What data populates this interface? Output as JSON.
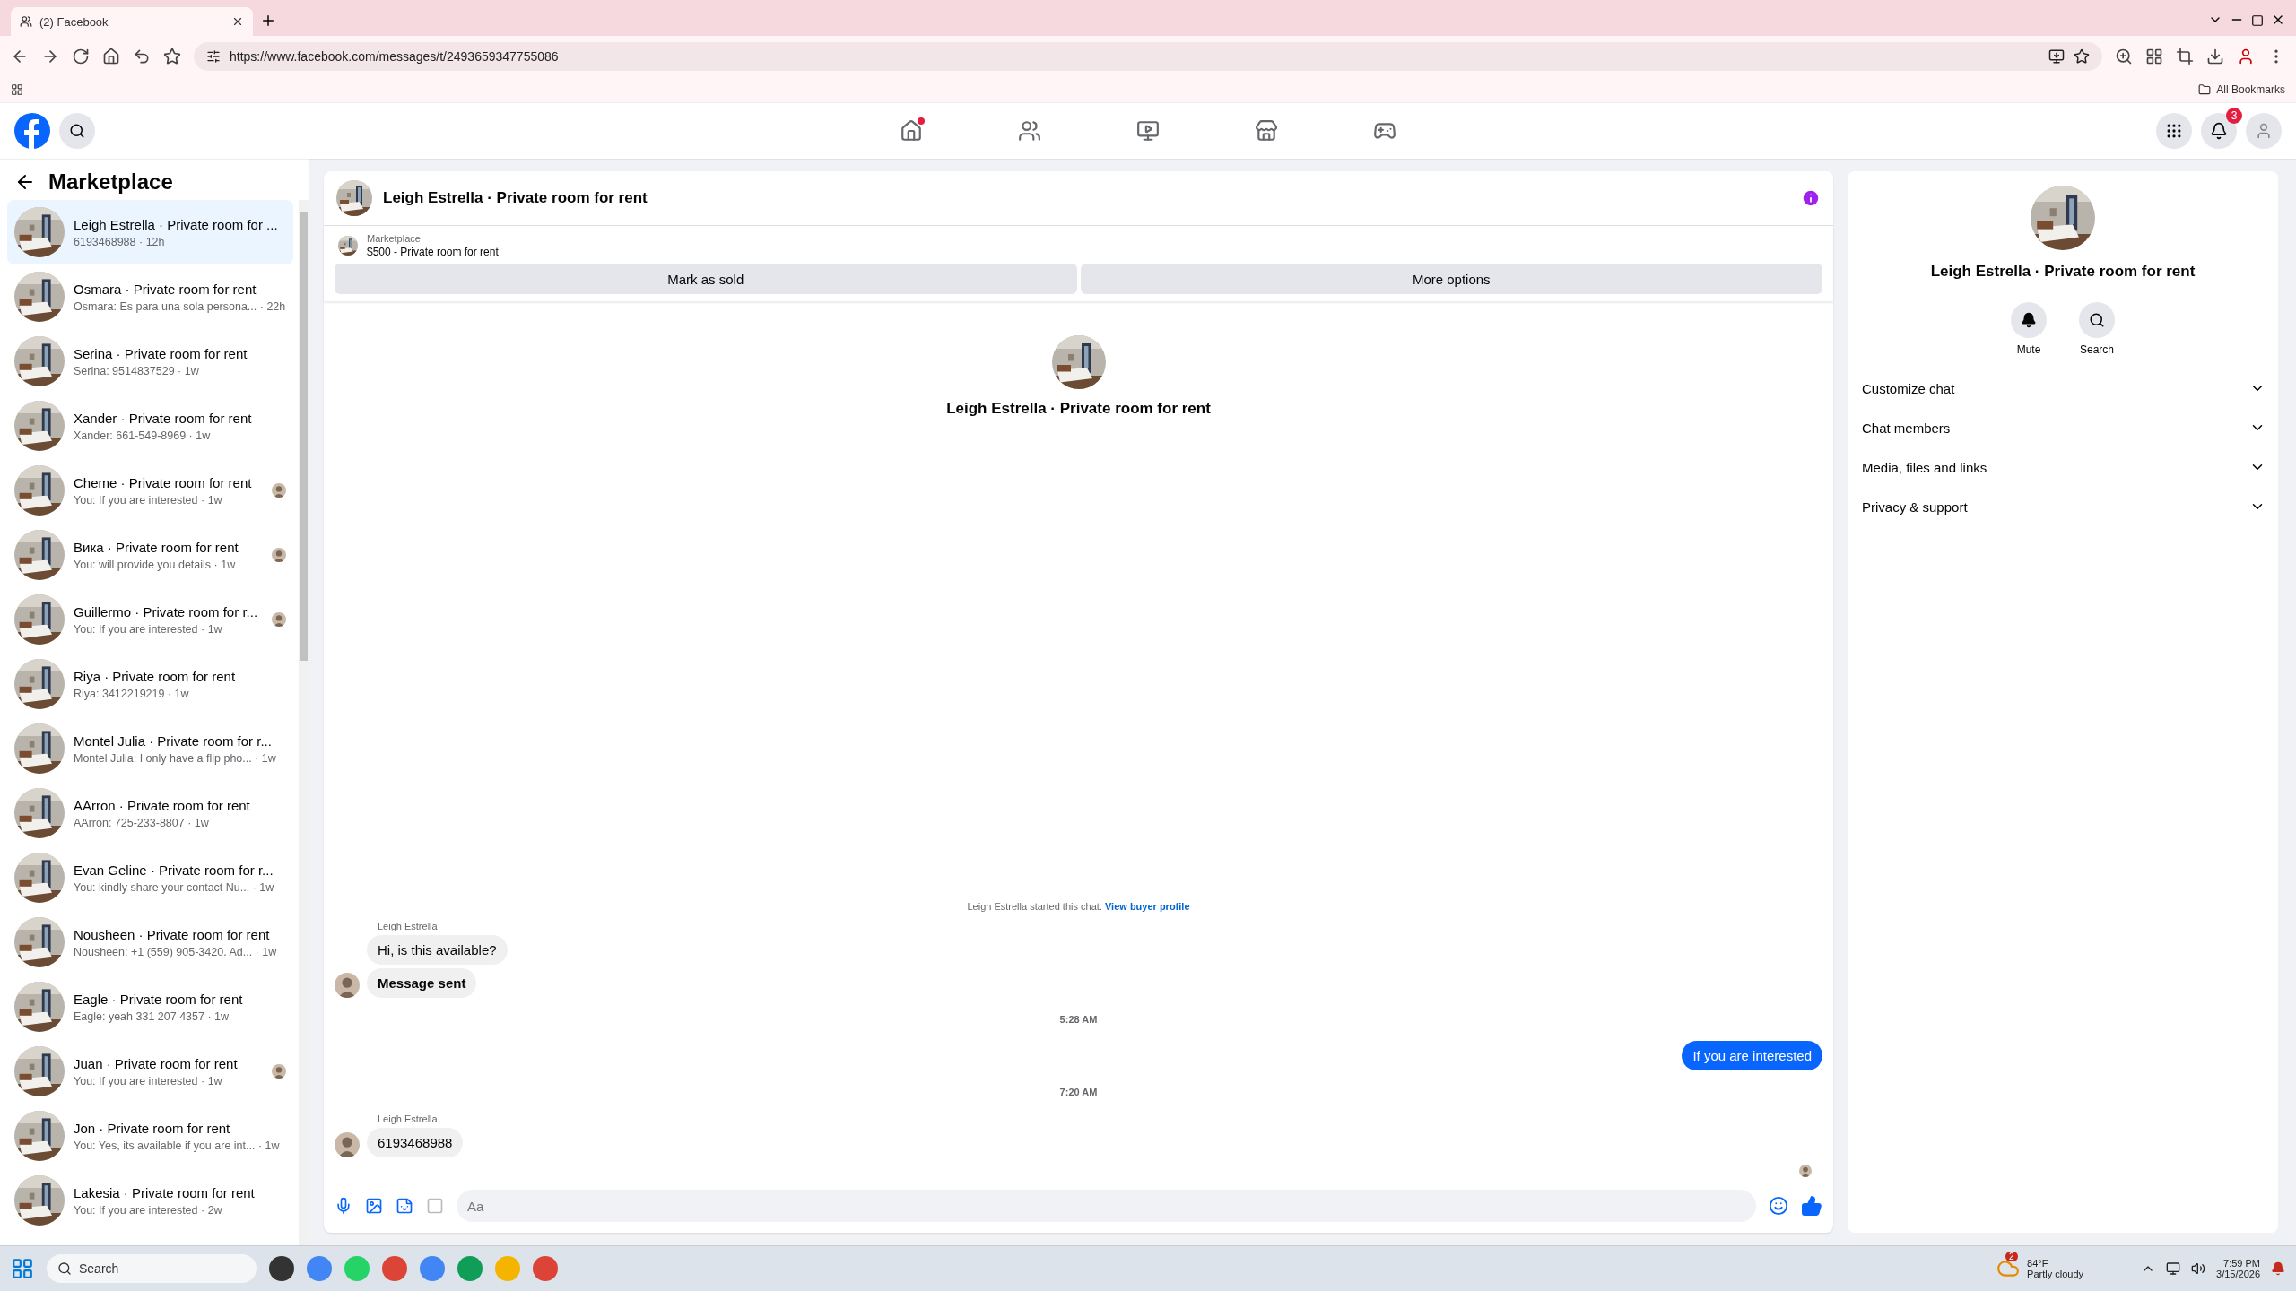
{
  "browser": {
    "tab_title": "(2) Facebook",
    "url": "https://www.facebook.com/messages/t/2493659347755086",
    "bookmarks_label": "All Bookmarks"
  },
  "topbar": {
    "notification_count": "3"
  },
  "sidebar": {
    "title": "Marketplace",
    "items": [
      {
        "name": "Leigh Estrella · Private room for ...",
        "preview": "6193468988 · 12h",
        "selected": true,
        "seen_avatar": false
      },
      {
        "name": "Osmara · Private room for rent",
        "preview": "Osmara: Es para una sola persona... · 22h",
        "selected": false,
        "seen_avatar": false
      },
      {
        "name": "Serina · Private room for rent",
        "preview": "Serina: 9514837529 · 1w",
        "selected": false,
        "seen_avatar": false
      },
      {
        "name": "Xander · Private room for rent",
        "preview": "Xander: 661-549-8969 · 1w",
        "selected": false,
        "seen_avatar": false
      },
      {
        "name": "Cheme · Private room for rent",
        "preview": "You: If you are interested · 1w",
        "selected": false,
        "seen_avatar": true
      },
      {
        "name": "Вика · Private room for rent",
        "preview": "You: will provide you details · 1w",
        "selected": false,
        "seen_avatar": true
      },
      {
        "name": "Guillermo · Private room for r...",
        "preview": "You: If you are interested · 1w",
        "selected": false,
        "seen_avatar": true
      },
      {
        "name": "Riya · Private room for rent",
        "preview": "Riya: 3412219219 · 1w",
        "selected": false,
        "seen_avatar": false
      },
      {
        "name": "Montel Julia · Private room for r...",
        "preview": "Montel Julia: I only have a flip pho... · 1w",
        "selected": false,
        "seen_avatar": false
      },
      {
        "name": "AArron · Private room for rent",
        "preview": "AArron: 725-233-8807 · 1w",
        "selected": false,
        "seen_avatar": false
      },
      {
        "name": "Evan Geline · Private room for r...",
        "preview": "You: kindly share your contact Nu... · 1w",
        "selected": false,
        "seen_avatar": false
      },
      {
        "name": "Nousheen · Private room for rent",
        "preview": "Nousheen: +1 (559) 905-3420. Ad... · 1w",
        "selected": false,
        "seen_avatar": false
      },
      {
        "name": "Eagle · Private room for rent",
        "preview": "Eagle: yeah 331 207 4357 · 1w",
        "selected": false,
        "seen_avatar": false
      },
      {
        "name": "Juan · Private room for rent",
        "preview": "You: If you are interested · 1w",
        "selected": false,
        "seen_avatar": true
      },
      {
        "name": "Jon · Private room for rent",
        "preview": "You: Yes, its available if you are int... · 1w",
        "selected": false,
        "seen_avatar": false
      },
      {
        "name": "Lakesia · Private room for rent",
        "preview": "You: If you are interested · 2w",
        "selected": false,
        "seen_avatar": false
      }
    ]
  },
  "chat": {
    "title": "Leigh Estrella · Private room for rent",
    "listing": {
      "label": "Marketplace",
      "price_title": "$500 - Private room for rent"
    },
    "actions": [
      "Mark as sold",
      "More options"
    ],
    "profile_title": "Leigh Estrella · Private room for rent",
    "messages": [
      {
        "kind": "notice",
        "text": "Leigh Estrella started this chat.",
        "link": "View buyer profile"
      },
      {
        "kind": "incoming",
        "sender": "Leigh Estrella",
        "bubbles": [
          {
            "text": "Hi, is this available?",
            "bold": false
          },
          {
            "text": "Message sent",
            "bold": true
          }
        ]
      },
      {
        "kind": "time",
        "text": "5:28 AM"
      },
      {
        "kind": "outgoing",
        "text": "If you are interested"
      },
      {
        "kind": "time",
        "text": "7:20 AM"
      },
      {
        "kind": "incoming",
        "sender": "Leigh Estrella",
        "bubbles": [
          {
            "text": "6193468988",
            "bold": false
          }
        ]
      }
    ],
    "composer": {
      "placeholder": "Aa"
    }
  },
  "details": {
    "title": "Leigh Estrella · Private room for rent",
    "actions": [
      {
        "kind": "mute",
        "label": "Mute"
      },
      {
        "kind": "search",
        "label": "Search"
      }
    ],
    "sections": [
      {
        "label": "Customize chat",
        "expanded": false
      },
      {
        "label": "Chat members",
        "expanded": false
      },
      {
        "label": "Media, files and links",
        "expanded": false
      },
      {
        "label": "Privacy & support",
        "expanded": false
      }
    ]
  },
  "taskbar": {
    "search_placeholder": "Search",
    "weather_badge": "2",
    "temperature": "84°F",
    "weather": "Partly cloudy",
    "time": "7:59 PM",
    "date": "3/15/2026"
  }
}
